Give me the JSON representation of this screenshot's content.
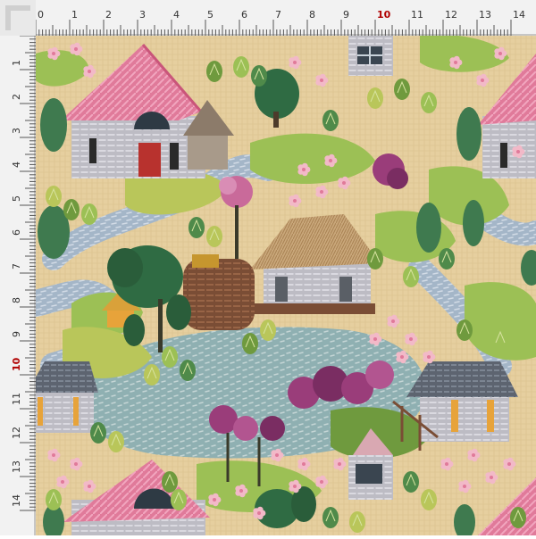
{
  "ruler": {
    "top_labels": [
      "0",
      "1",
      "2",
      "3",
      "4",
      "5",
      "6",
      "7",
      "8",
      "9",
      "10",
      "11",
      "12",
      "13",
      "14"
    ],
    "left_labels": [
      "1",
      "2",
      "3",
      "4",
      "5",
      "6",
      "7",
      "8",
      "9",
      "10",
      "11",
      "12",
      "13",
      "14"
    ],
    "highlight_label": "10",
    "highlight_color": "#b00000"
  },
  "artwork": {
    "style": "embroidered-fabric",
    "palette": {
      "fabric": "#e6cf9f",
      "roof_pink": "#e07a9a",
      "wall_grey": "#bdbcc4",
      "water": "#8fb0b2",
      "path_blue": "#a4b6c8",
      "tree_green": "#2f6b43",
      "light_green": "#9cc055",
      "flower_pink": "#f2b9c8",
      "flower_purple": "#9a3d7a",
      "roof_thatch": "#c9a77a",
      "roof_dark": "#5d6470"
    }
  }
}
